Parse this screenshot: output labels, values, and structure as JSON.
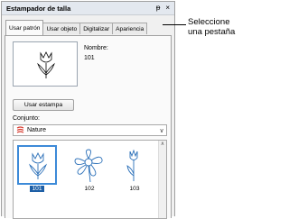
{
  "window": {
    "title": "Estampador de talla",
    "pin_glyph": "ᵽ",
    "close_glyph": "×"
  },
  "tabs": [
    {
      "label": "Usar patrón",
      "active": true
    },
    {
      "label": "Usar objeto",
      "active": false
    },
    {
      "label": "Digitalizar",
      "active": false
    },
    {
      "label": "Apariencia",
      "active": false
    }
  ],
  "preview": {
    "name_label": "Nombre:",
    "name_value": "101",
    "icon": "tulip-icon"
  },
  "buttons": {
    "use_stamp": "Usar estampa"
  },
  "set": {
    "label": "Conjunto:",
    "selected": "Nature",
    "icon": "nature-set-icon"
  },
  "thumbnails": [
    {
      "label": "101",
      "icon": "tulip-icon",
      "selected": true
    },
    {
      "label": "102",
      "icon": "flower-icon",
      "selected": false
    },
    {
      "label": "103",
      "icon": "single-tulip-icon",
      "selected": false
    }
  ],
  "callout": {
    "line1": "Seleccione",
    "line2": "una pestaña"
  },
  "colors": {
    "selection": "#3c8ad8",
    "label_highlight": "#1e5fa6",
    "set_icon": "#d83a2e"
  }
}
